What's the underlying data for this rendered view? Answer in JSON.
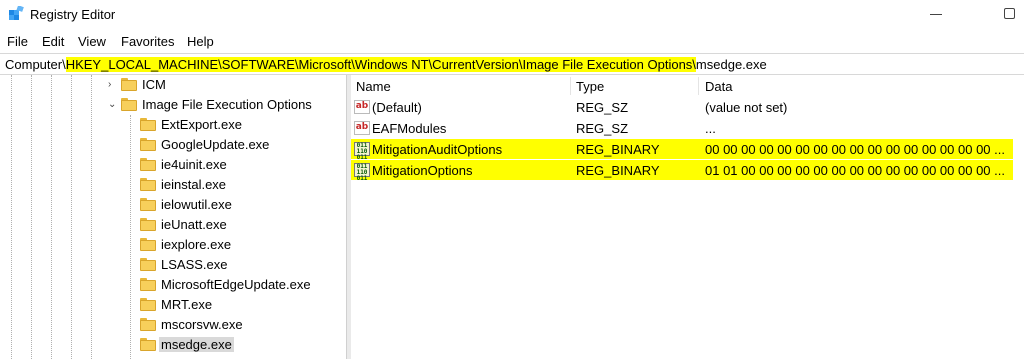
{
  "window": {
    "title": "Registry Editor"
  },
  "menu": [
    "File",
    "Edit",
    "View",
    "Favorites",
    "Help"
  ],
  "address": {
    "prefix": "Computer\\",
    "highlighted": "HKEY_LOCAL_MACHINE\\SOFTWARE\\Microsoft\\Windows NT\\CurrentVersion\\Image File Execution Options\\",
    "suffix": "msedge.exe"
  },
  "tree": {
    "items": [
      {
        "label": "ICM",
        "arrow": "›"
      },
      {
        "label": "Image File Execution Options",
        "arrow": "⌄"
      },
      {
        "label": "ExtExport.exe"
      },
      {
        "label": "GoogleUpdate.exe"
      },
      {
        "label": "ie4uinit.exe"
      },
      {
        "label": "ieinstal.exe"
      },
      {
        "label": "ielowutil.exe"
      },
      {
        "label": "ieUnatt.exe"
      },
      {
        "label": "iexplore.exe"
      },
      {
        "label": "LSASS.exe"
      },
      {
        "label": "MicrosoftEdgeUpdate.exe"
      },
      {
        "label": "MRT.exe"
      },
      {
        "label": "mscorsvw.exe"
      },
      {
        "label": "msedge.exe"
      }
    ],
    "selected": "msedge.exe"
  },
  "list": {
    "columns": [
      "Name",
      "Type",
      "Data"
    ],
    "rows": [
      {
        "name": "(Default)",
        "type": "REG_SZ",
        "data": "(value not set)",
        "icon": "string-value-icon"
      },
      {
        "name": "EAFModules",
        "type": "REG_SZ",
        "data": "...",
        "icon": "string-value-icon"
      },
      {
        "name": "MitigationAuditOptions",
        "type": "REG_BINARY",
        "data": "00 00 00 00 00 00 00 00 00 00 00 00 00 00 00 00 ...",
        "icon": "binary-value-icon"
      },
      {
        "name": "MitigationOptions",
        "type": "REG_BINARY",
        "data": "01 01 00 00 00 00 00 00 00 00 00 00 00 00 00 00 ...",
        "icon": "binary-value-icon"
      }
    ]
  },
  "icons": {
    "string": "ab",
    "binary": "011\n110"
  },
  "colors": {
    "highlight": "#ffff00",
    "selection": "#d9d9d9",
    "folder": "#f7cf5b"
  }
}
